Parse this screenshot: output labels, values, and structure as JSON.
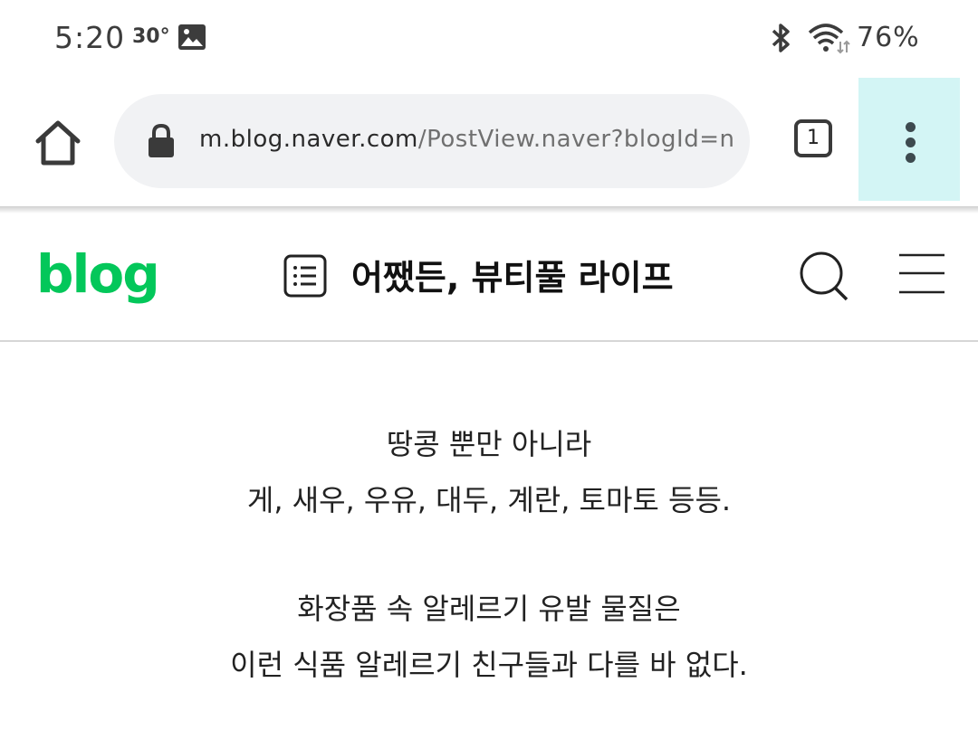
{
  "status_bar": {
    "time": "5:20",
    "temperature": "30°",
    "battery": "76%",
    "icons": [
      "gallery-icon",
      "bluetooth-icon",
      "wifi-icon"
    ]
  },
  "browser": {
    "url_host": "m.blog.naver.com",
    "url_path": "/PostView.naver?blogId=nc",
    "tab_count": "1",
    "icons": [
      "home-icon",
      "lock-icon",
      "more-vert-icon"
    ],
    "menu_highlight_color": "#d3f5f5"
  },
  "blog_header": {
    "logo": "blog",
    "title": "어쨌든, 뷰티풀 라이프",
    "brand_color": "#03c75a",
    "icons": [
      "post-list-icon",
      "search-icon",
      "hamburger-menu-icon"
    ]
  },
  "post": {
    "paragraphs": [
      [
        "땅콩 뿐만 아니라",
        "게, 새우, 우유, 대두, 계란, 토마토 등등."
      ],
      [
        "화장품 속 알레르기 유발 물질은",
        "이런 식품 알레르기 친구들과 다를 바 없다."
      ]
    ]
  }
}
